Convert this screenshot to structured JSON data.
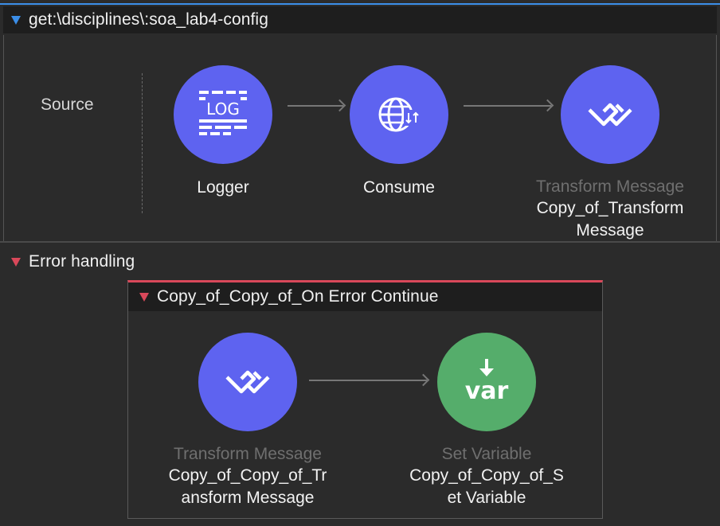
{
  "flow": {
    "title": "get:\\disciplines\\:soa_lab4-config",
    "source_label": "Source",
    "components": [
      {
        "type": "",
        "name": "Logger",
        "icon": "logger-icon",
        "color": "#5e63f0"
      },
      {
        "type": "",
        "name": "Consume",
        "icon": "globe-icon",
        "color": "#5e63f0"
      },
      {
        "type": "Transform Message",
        "name": "Copy_of_Transform\nMessage",
        "icon": "transform-icon",
        "color": "#5e63f0"
      }
    ]
  },
  "error_handling": {
    "title": "Error handling",
    "handler": {
      "title": "Copy_of_Copy_of_On Error Continue",
      "components": [
        {
          "type": "Transform Message",
          "name": "Copy_of_Copy_of_Tr\nansform Message",
          "icon": "transform-icon",
          "color": "#5e63f0"
        },
        {
          "type": "Set Variable",
          "name": "Copy_of_Copy_of_S\net Variable",
          "icon": "set-variable-icon",
          "color": "#55ad6b"
        }
      ]
    }
  },
  "icons": {
    "logger_text": "LOG",
    "var_text": "var"
  },
  "colors": {
    "flow_accent": "#3b8ee8",
    "error_accent": "#d9485a"
  }
}
